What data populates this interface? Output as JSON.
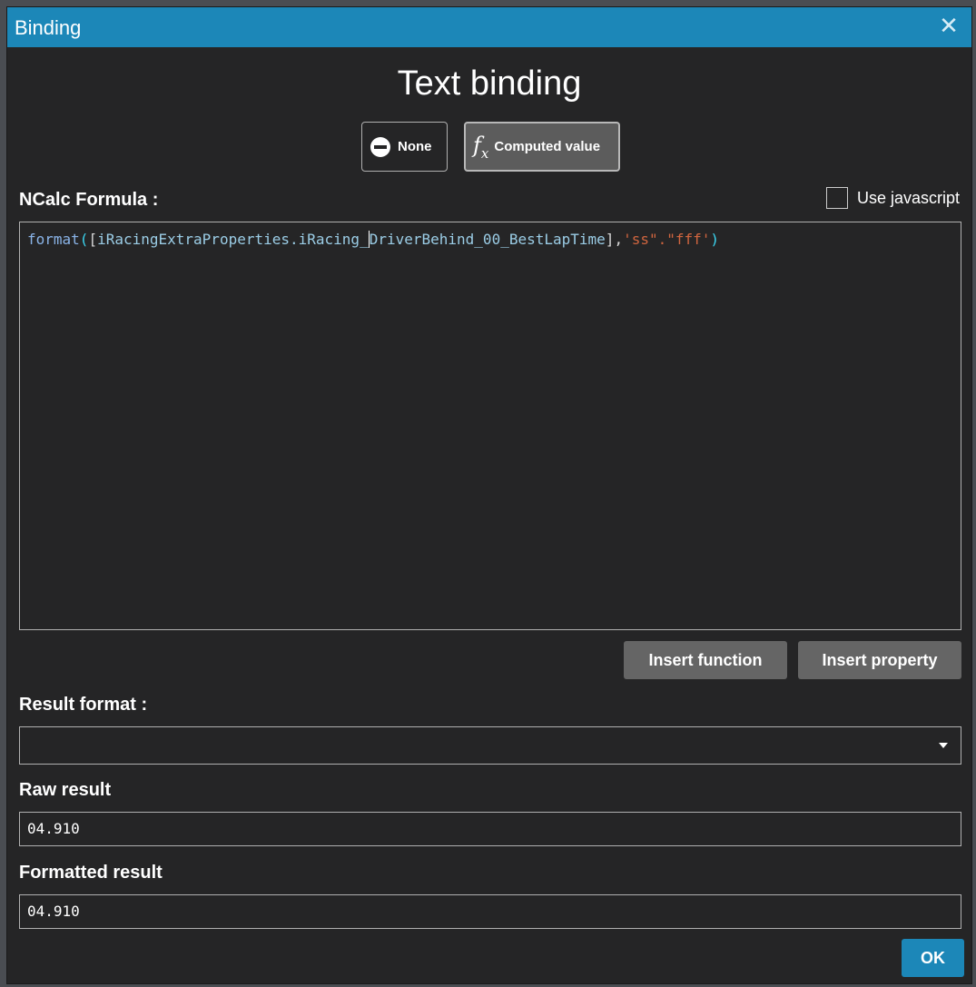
{
  "window": {
    "title": "Binding",
    "close_glyph": "✕"
  },
  "heading": "Text binding",
  "mode_buttons": {
    "none_label": "None",
    "computed_label": "Computed value",
    "selected": "Computed value"
  },
  "formula": {
    "label": "NCalc Formula :",
    "use_javascript_label": "Use javascript",
    "use_javascript_checked": false,
    "tokens": {
      "fn": "format",
      "open_paren": "(",
      "open_bracket": "[",
      "prop_before_cursor": "iRacingExtraProperties.iRacing_",
      "prop_after_cursor": "DriverBehind_00_BestLapTime",
      "close_bracket": "]",
      "comma": ",",
      "string": "'ss\".\"fff'",
      "close_paren": ")"
    }
  },
  "buttons": {
    "insert_function": "Insert function",
    "insert_property": "Insert property",
    "ok": "OK"
  },
  "result_format": {
    "label": "Result format :",
    "value": ""
  },
  "raw_result": {
    "label": "Raw result",
    "value": "04.910"
  },
  "formatted_result": {
    "label": "Formatted result",
    "value": "04.910"
  },
  "colors": {
    "titlebar": "#1c87b8",
    "background": "#252526",
    "button": "#656565",
    "accent": "#1c87b8"
  }
}
